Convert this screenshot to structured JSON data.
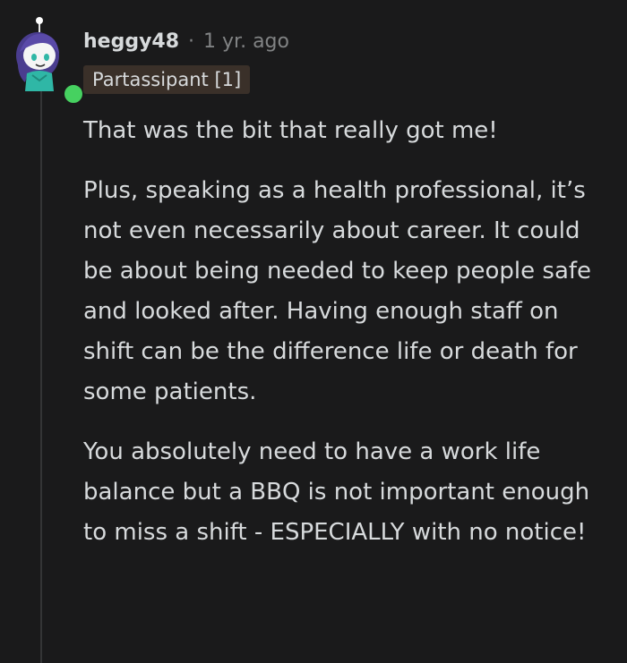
{
  "comment": {
    "username": "heggy48",
    "separator": "·",
    "timestamp": "1 yr. ago",
    "flair": "Partassipant [1]",
    "avatar_icon": "snoo-avatar-icon",
    "online_status_color": "#46d160",
    "paragraphs": [
      "That was the bit that really got me!",
      "Plus, speaking as a health professional, it’s not even necessarily about career. It could be about being needed to keep people safe and looked after. Having enough staff on shift can be the difference life or death for some patients.",
      "You absolutely need to have a work life balance but a BBQ is not important enough to miss a shift - ESPECIALLY with no notice!"
    ]
  },
  "colors": {
    "background": "#1a1a1b",
    "text": "#d7dadc",
    "muted": "#818384",
    "flair_bg": "#3a3029"
  }
}
